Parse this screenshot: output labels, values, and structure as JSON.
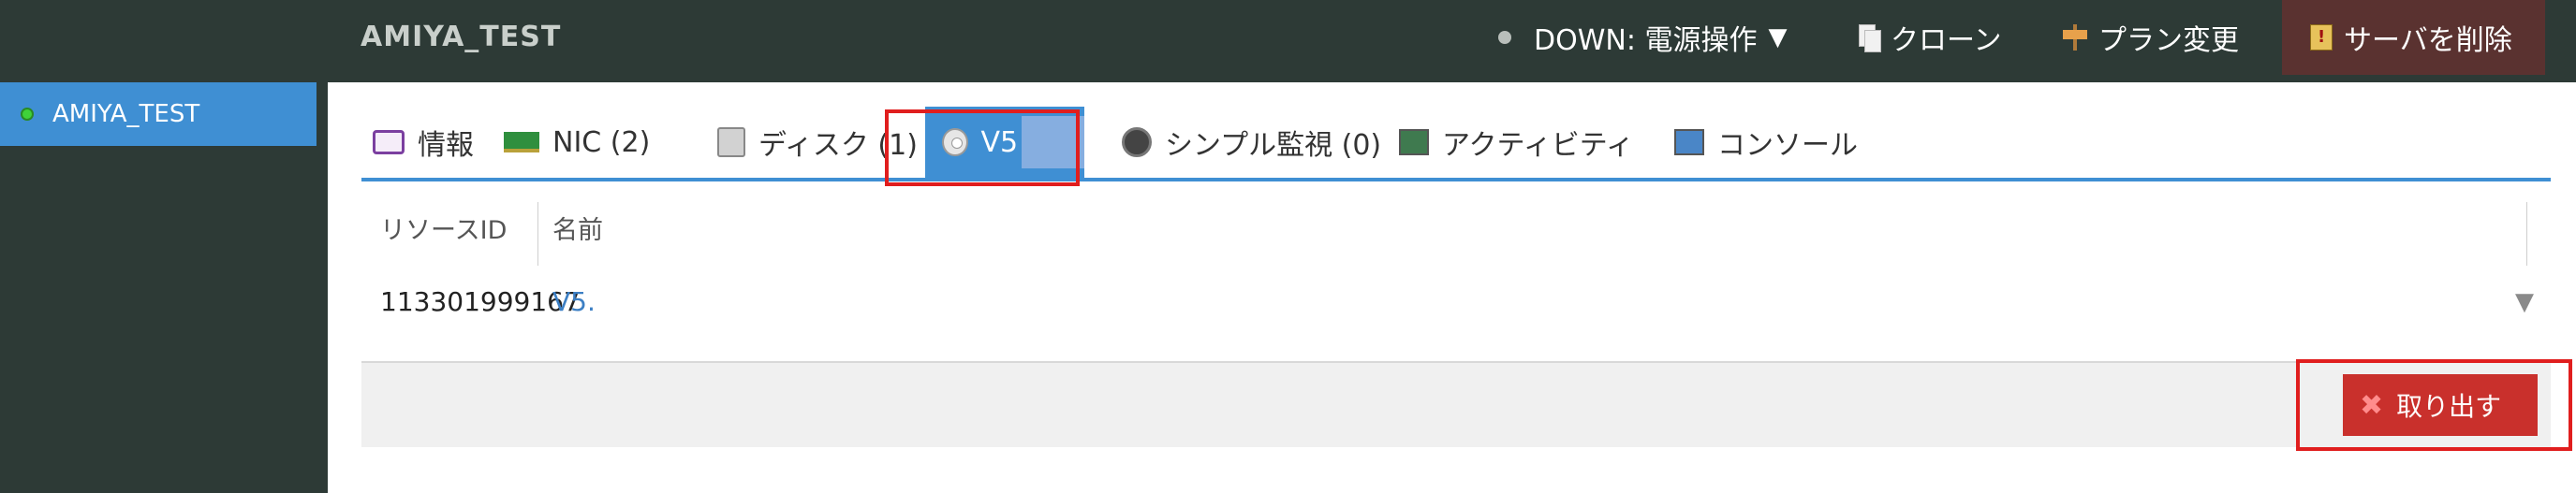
{
  "header": {
    "server_name": "AMIYA_TEST",
    "status_text": "DOWN: 電源操作",
    "status_caret": "▼",
    "clone_label": "クローン",
    "plan_change_label": "プラン変更",
    "delete_server_label": "サーバを削除"
  },
  "sidebar": {
    "items": [
      {
        "label": "AMIYA_TEST",
        "status_color": "#3fd13a"
      }
    ]
  },
  "tabs": {
    "info": "情報",
    "nic": "NIC (2)",
    "disk": "ディスク (1)",
    "iso": "V5",
    "simple_monitor": "シンプル監視 (0)",
    "activity": "アクティビティ",
    "console": "コンソール"
  },
  "table": {
    "headers": {
      "resource_id": "リソースID",
      "name": "名前"
    },
    "rows": [
      {
        "resource_id": "113301999167",
        "name": "V5."
      }
    ],
    "row_caret": "▼"
  },
  "actions": {
    "eject_label": "取り出す"
  },
  "colors": {
    "accent": "#3f8fd3",
    "danger": "#c9302c",
    "highlight": "#e01e1e"
  },
  "icons": {
    "info": "info-icon",
    "nic": "nic-card-icon",
    "disk": "disk-icon",
    "iso": "cd-icon",
    "monitor": "monitor-eye-icon",
    "activity": "activity-monitor-icon",
    "console": "console-monitor-icon",
    "clone": "document-copy-icon",
    "plan": "signpost-icon",
    "delete": "trash-warning-icon",
    "eject": "close-x-icon"
  }
}
